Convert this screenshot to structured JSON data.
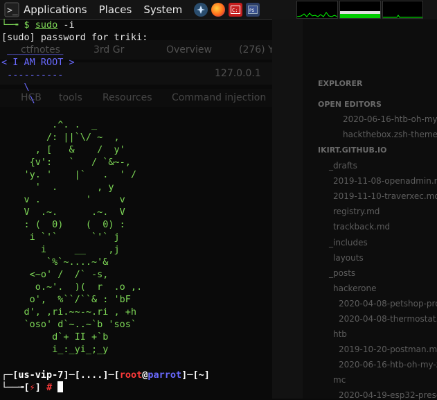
{
  "topbar": {
    "menus": [
      "Applications",
      "Places",
      "System"
    ],
    "launchers": [
      "parrot-icon",
      "firefox-icon",
      "terminal-icon",
      "powershell-icon"
    ]
  },
  "background": {
    "tabs": [
      "ctfnotes",
      "3rd Gr",
      "Overview",
      "(276) Y"
    ],
    "address": "127.0.0.1",
    "bookmarks": [
      "HCB",
      "tools",
      "Resources",
      "Command injection"
    ],
    "explorer": {
      "title": "EXPLORER",
      "open_editors": "OPEN EDITORS",
      "open_files": [
        "2020-06-16-htb-oh-my-...",
        "hackthebox.zsh-theme"
      ],
      "workspace": "IKIRT.GITHUB.IO",
      "tree": [
        "_drafts",
        "2019-11-08-openadmin.m...",
        "2019-11-10-traverxec.md",
        "registry.md",
        "trackback.md",
        "_includes",
        "layouts",
        "_posts",
        "hackerone",
        "2020-04-08-petshop-pro...",
        "2020-04-08-thermostat.m...",
        "htb",
        "2019-10-20-postman.md",
        "2020-06-16-htb-oh-my-z...",
        "mc",
        "2020-04-19-esp32-prese..."
      ]
    }
  },
  "terminal": {
    "cmd_prefix": "└─╼ $ ",
    "cmd_sudo": "sudo",
    "cmd_args": " -i",
    "password_prompt": "[sudo] password for triki:",
    "banner": [
      " __________",
      "< I AM ROOT >",
      " ----------",
      "    \\",
      "     \\"
    ],
    "art": [
      "         .^. .  _",
      "        /: ||`\\/ ~  ,",
      "      , [   &    /  y'",
      "     {v':   `   / `&~-,",
      "    'y. '    |`   .  ' /",
      "      '  .       , y",
      "    v .        '     v",
      "    V  .~.      .~.  V",
      "    : (  0)    (  0) :",
      "     i `'`      `'` j",
      "       i     __    ,j",
      "        `%`~....~'&",
      "     <~o' /  /` -s,",
      "      o.~'.  )(  r  .o ,.",
      "     o',  %``/``& : 'bF",
      "    d', ,ri.~~-~.ri , +h",
      "    `oso' d`~..~`b 'sos`",
      "         d`+ II +`b",
      "         i_:_yi_;_y"
    ],
    "prompt": {
      "user_host_left": "[us-vip-7]",
      "dots": "[....]",
      "user": "root",
      "at": "@",
      "host": "parrot",
      "path": "[~]",
      "lightning": "⚡",
      "hash": "#"
    }
  },
  "colors": {
    "prompt_green": "#7ed957",
    "banner_blue": "#6a6aff",
    "root_red": "#ff3b3b",
    "graph_green": "#00ff00"
  }
}
